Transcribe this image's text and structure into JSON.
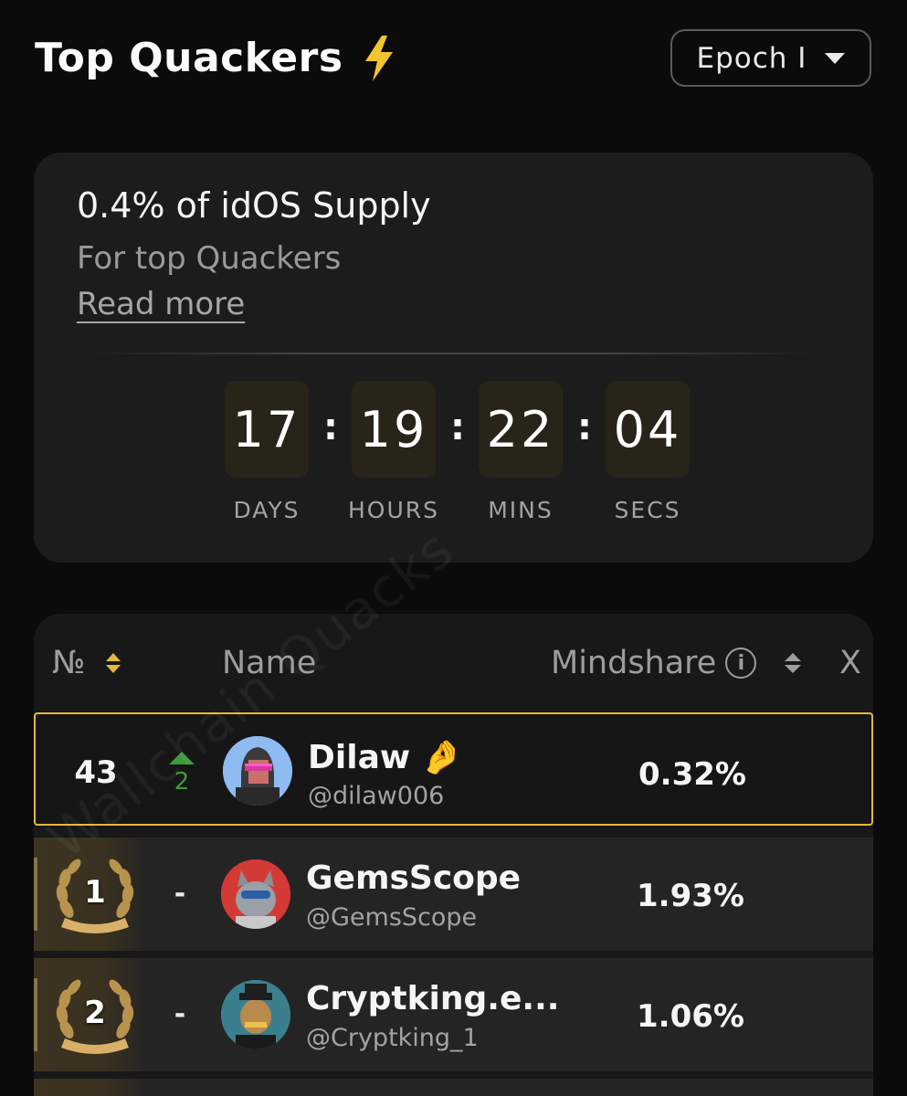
{
  "header": {
    "title": "Top Quackers",
    "epoch_selected": "Epoch I"
  },
  "supply_card": {
    "heading": "0.4% of idOS Supply",
    "subheading": "For top Quackers",
    "read_more": "Read more",
    "countdown": {
      "days": "17",
      "hours": "19",
      "mins": "22",
      "secs": "04",
      "days_label": "DAYS",
      "hours_label": "HOURS",
      "mins_label": "MINS",
      "secs_label": "SECS"
    }
  },
  "table": {
    "col_rank": "№",
    "col_name": "Name",
    "col_mindshare": "Mindshare",
    "col_x": "X",
    "current_user": {
      "rank": "43",
      "change": "2",
      "name": "Dilaw",
      "emoji": "🤌",
      "handle": "@dilaw006",
      "mindshare": "0.32%"
    },
    "rows": [
      {
        "rank": "1",
        "change": "-",
        "name": "GemsScope",
        "handle": "@GemsScope",
        "mindshare": "1.93%"
      },
      {
        "rank": "2",
        "change": "-",
        "name": "Cryptking.e...",
        "handle": "@Cryptking_1",
        "mindshare": "1.06%"
      }
    ]
  },
  "watermark": "Wallchain Quacks",
  "colors": {
    "accent_gold": "#e2b93b",
    "bolt_yellow": "#f4c430",
    "up_green": "#3d9a3d"
  }
}
